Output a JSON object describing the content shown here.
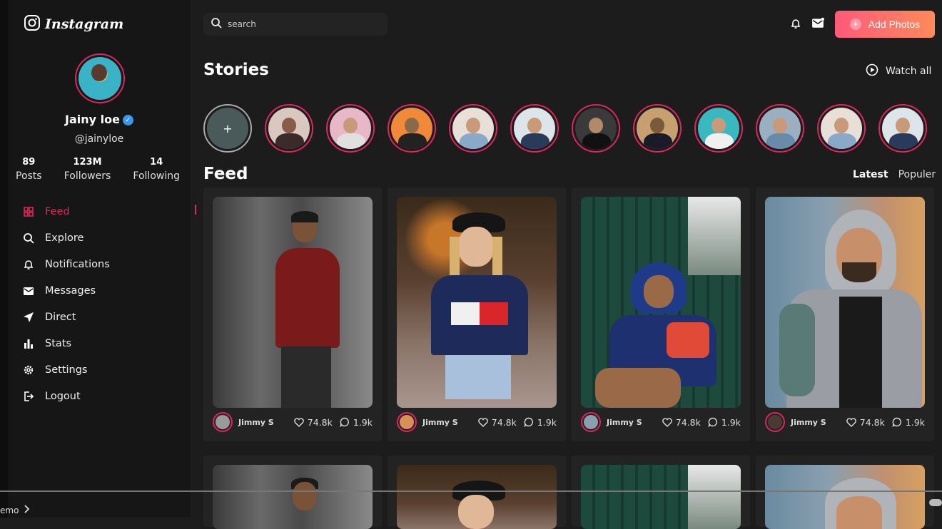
{
  "app": {
    "logo_text": "Instagram"
  },
  "profile": {
    "name": "Jainy loe",
    "handle": "@jainyloe"
  },
  "stats": [
    {
      "num": "89",
      "label": "Posts"
    },
    {
      "num": "123M",
      "label": "Followers"
    },
    {
      "num": "14",
      "label": "Following"
    }
  ],
  "nav": [
    {
      "label": "Feed",
      "icon": "grid-icon",
      "active": true
    },
    {
      "label": "Explore",
      "icon": "search-icon"
    },
    {
      "label": "Notifications",
      "icon": "bell-icon"
    },
    {
      "label": "Messages",
      "icon": "mail-icon"
    },
    {
      "label": "Direct",
      "icon": "send-icon"
    },
    {
      "label": "Stats",
      "icon": "bar-chart-icon"
    },
    {
      "label": "Settings",
      "icon": "gear-icon"
    },
    {
      "label": "Logout",
      "icon": "logout-icon"
    }
  ],
  "header": {
    "search_placeholder": "search",
    "add_button": "Add Photos"
  },
  "stories": {
    "title": "Stories",
    "watch_all": "Watch all",
    "add_symbol": "+"
  },
  "feed": {
    "title": "Feed",
    "tabs": [
      "Latest",
      "Populer"
    ],
    "posts": [
      {
        "author": "Jimmy S",
        "likes": "74.8k",
        "comments": "1.9k"
      },
      {
        "author": "Jimmy S",
        "likes": "74.8k",
        "comments": "1.9k"
      },
      {
        "author": "Jimmy S",
        "likes": "74.8k",
        "comments": "1.9k"
      },
      {
        "author": "Jimmy S",
        "likes": "74.8k",
        "comments": "1.9k"
      }
    ]
  },
  "bottom": {
    "label": "emo"
  },
  "colors": {
    "accent": "#e0245e",
    "button_start": "#ff5a7a",
    "button_end": "#ff8a5a",
    "background": "#1c1c1c",
    "sidebar": "#161616"
  }
}
